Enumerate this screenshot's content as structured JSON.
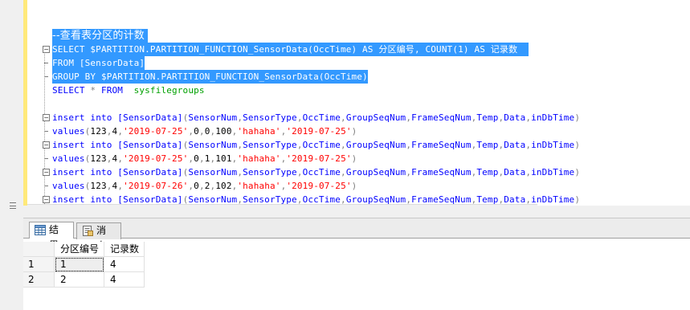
{
  "editor": {
    "lines": [
      {
        "text": "--查看表分区的计数",
        "kind": "comment",
        "selected": true
      },
      {
        "text": "SELECT $PARTITION.PARTITION_FUNCTION_SensorData(OccTime) AS 分区编号, COUNT(1) AS 记录数",
        "kind": "select1",
        "selected": true
      },
      {
        "text": "FROM [SensorData]",
        "kind": "from",
        "selected": true
      },
      {
        "text": "GROUP BY $PARTITION.PARTITION_FUNCTION_SensorData(OccTime)",
        "kind": "groupby",
        "selected": true
      },
      {
        "text": "SELECT * FROM  sysfilegroups",
        "kind": "select2",
        "selected": false
      },
      {
        "text": "",
        "kind": "blank",
        "selected": false
      },
      {
        "text": "insert into [SensorData](SensorNum,SensorType,OccTime,GroupSeqNum,FrameSeqNum,Temp,Data,inDbTime)",
        "kind": "insert",
        "selected": false
      },
      {
        "text": "values(123,4,'2019-07-25',0,0,100,'hahaha','2019-07-25')",
        "kind": "values",
        "selected": false
      },
      {
        "text": "insert into [SensorData](SensorNum,SensorType,OccTime,GroupSeqNum,FrameSeqNum,Temp,Data,inDbTime)",
        "kind": "insert",
        "selected": false
      },
      {
        "text": "values(123,4,'2019-07-25',0,1,101,'hahaha','2019-07-25')",
        "kind": "values",
        "selected": false
      },
      {
        "text": "insert into [SensorData](SensorNum,SensorType,OccTime,GroupSeqNum,FrameSeqNum,Temp,Data,inDbTime)",
        "kind": "insert",
        "selected": false
      },
      {
        "text": "values(123,4,'2019-07-26',0,2,102,'hahaha','2019-07-25')",
        "kind": "values",
        "selected": false
      },
      {
        "text": "insert into [SensorData](SensorNum,SensorType,OccTime,GroupSeqNum,FrameSeqNum,Temp,Data,inDbTime)",
        "kind": "insert",
        "selected": false
      }
    ]
  },
  "results": {
    "tabs": [
      {
        "label": "结果",
        "icon": "grid-icon",
        "active": true
      },
      {
        "label": "消息",
        "icon": "messages-icon",
        "active": false
      }
    ],
    "columns": [
      "分区编号",
      "记录数"
    ],
    "rows": [
      {
        "rownum": "1",
        "cells": [
          "1",
          "4"
        ]
      },
      {
        "rownum": "2",
        "cells": [
          "2",
          "4"
        ]
      }
    ]
  },
  "colors": {
    "selection": "#3399ff",
    "keyword": "#0000ff",
    "comment": "#008000",
    "function": "#ff00ff",
    "system_table": "#00a000",
    "string": "#ff0000",
    "change_marker": "#ffe97a"
  }
}
